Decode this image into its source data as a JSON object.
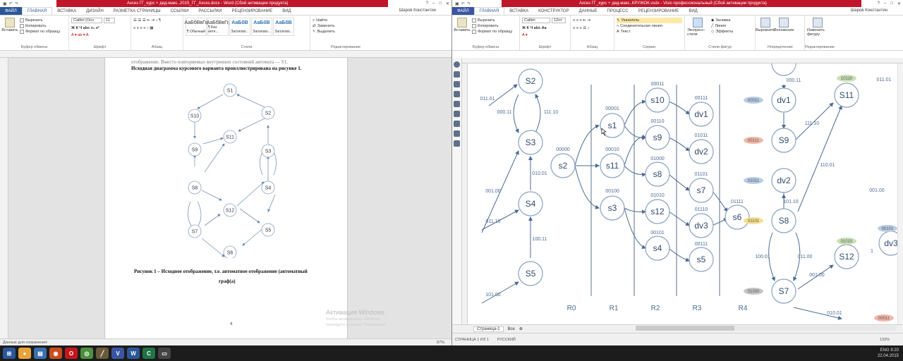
{
  "word": {
    "title": "Ахсез ГГ_курс + дед-макс..2015_ГГ_Ахсез.docx - Word (Сбой активации продукта)",
    "user": "Шаров Константин",
    "tabs": [
      "ФАЙЛ",
      "ГЛАВНАЯ",
      "ВСТАВКА",
      "ДИЗАЙН",
      "РАЗМЕТКА СТРАНИЦЫ",
      "ССЫЛКИ",
      "РАССЫЛКИ",
      "РЕЦЕНЗИРОВАНИЕ",
      "ВИД"
    ],
    "clipboard": {
      "paste": "Вставить",
      "cut": "Вырезать",
      "copy": "Копировать",
      "format": "Формат по образцу",
      "label": "Буфер обмена"
    },
    "font": {
      "name": "Calibri (Осн",
      "size": "11",
      "label": "Шрифт"
    },
    "paragraph_label": "Абзац",
    "styles": [
      {
        "sample": "АаБбВвГг,",
        "name": "¶ Обычный"
      },
      {
        "sample": "АаБбВвГг,",
        "name": "¶ Без инте..."
      },
      {
        "sample": "АаБбВ",
        "name": "Заголово..."
      },
      {
        "sample": "АаБбВ",
        "name": "Заголово..."
      },
      {
        "sample": "АаБбВ",
        "name": "Заголово..."
      }
    ],
    "styles_label": "Стили",
    "editing": {
      "find": "Найти",
      "replace": "Заменить",
      "select": "Выделить",
      "label": "Редактирование"
    },
    "doc_text": {
      "line1": "отображение. Вместо повторяемых внутренних состояний автомата — S1,",
      "line2": "Исходная диаграмма курсового варианта проиллюстрирована на рисунке 1.",
      "caption1": "Рисунок 1 – Исходное отображение, т.е. автоматное отображение (автоматный",
      "caption2": "граф(а)",
      "page_number": "4"
    },
    "activation": {
      "title": "Активация Windows",
      "sub1": "Чтобы активировать Windows,",
      "sub2": "перейдите в раздел \"Параметры\"."
    },
    "graph_nodes": [
      {
        "id": "S1"
      },
      {
        "id": "S10"
      },
      {
        "id": "S2"
      },
      {
        "id": "S11"
      },
      {
        "id": "S9"
      },
      {
        "id": "S3"
      },
      {
        "id": "S8"
      },
      {
        "id": "S4"
      },
      {
        "id": "S12"
      },
      {
        "id": "S7"
      },
      {
        "id": "S5"
      },
      {
        "id": "S6"
      }
    ],
    "status": {
      "left": "Данные для сохранения: "
    },
    "zoom": "87%"
  },
  "visio": {
    "title": "Ахсез ГГ_курс + дед-макс..КРУЖОК.vsdx - Visio профессиональный (Сбой активации продукта)",
    "user": "Шаров Константин",
    "tabs": [
      "ФАЙЛ",
      "ГЛАВНАЯ",
      "ВСТАВКА",
      "КОНСТРУКТОР",
      "ДАННЫЕ",
      "ПРОЦЕСС",
      "РЕЦЕНЗИРОВАНИЕ",
      "ВИД"
    ],
    "clipboard": {
      "paste": "Вставить",
      "cut": "Вырезать",
      "copy": "Копировать",
      "format": "Формат по образцу",
      "label": "Буфер обмена"
    },
    "font": {
      "name": "Calibri",
      "size": "12пт",
      "label": "Шрифт"
    },
    "paragraph_label": "Абзац",
    "tools": {
      "pointer": "Указатель",
      "connector": "Соединительная линия",
      "text": "Текст",
      "label": "Сервис"
    },
    "shape_styles": {
      "express": "Экспресс-стили",
      "fill": "Заливка",
      "line": "Линия",
      "effects": "Эффекты",
      "label": "Стили фигур"
    },
    "arrange": {
      "align": "Выровнять",
      "position": "Положение",
      "label": "Упорядочение"
    },
    "editing": {
      "change_shape": "Изменить фигуру",
      "label": "Редактирование"
    },
    "page_tab": "Страница-1",
    "all_tab": "Все",
    "status": {
      "page": "СТРАНИЦА 1 ИЗ 1",
      "lang": "РУССКИЙ"
    },
    "zoom": "133%",
    "regions": [
      "R0",
      "R1",
      "R2",
      "R3",
      "R4"
    ],
    "left_states": [
      "S2",
      "S3",
      "S4",
      "S5"
    ],
    "left_labels": [
      "011.01",
      "000.11",
      "111.10",
      "010.01",
      "001.00",
      "011.10",
      "100.11",
      "101.00"
    ],
    "mid_nodes": [
      "s2",
      "s1",
      "s11",
      "s3",
      "s10",
      "s9",
      "s8",
      "s12",
      "s4",
      "dv1",
      "dv2",
      "s7",
      "dv3",
      "s5",
      "s6"
    ],
    "mid_codes": [
      "00000",
      "00001",
      "00010",
      "00100",
      "00011",
      "00110",
      "01000",
      "01010",
      "00101",
      "00111",
      "01011",
      "01101",
      "01110",
      "00111",
      "01111"
    ],
    "right_states": [
      "dv1",
      "S9",
      "dv2",
      "S8",
      "S7",
      "S11",
      "S12",
      "dv3"
    ],
    "right_labels": [
      "000.11",
      "111.10",
      "110.01",
      "011.01",
      "101.10",
      "001.00",
      "100.01",
      "011.00",
      "001.00",
      "010.01",
      "1"
    ],
    "ovals": [
      "10110",
      "00011",
      "00111",
      "01011",
      "01101",
      "01000",
      "01010",
      "00101",
      "00011"
    ]
  },
  "taskbar": {
    "time": "9:20",
    "date": "22.04.2015",
    "lang": "ENG"
  }
}
